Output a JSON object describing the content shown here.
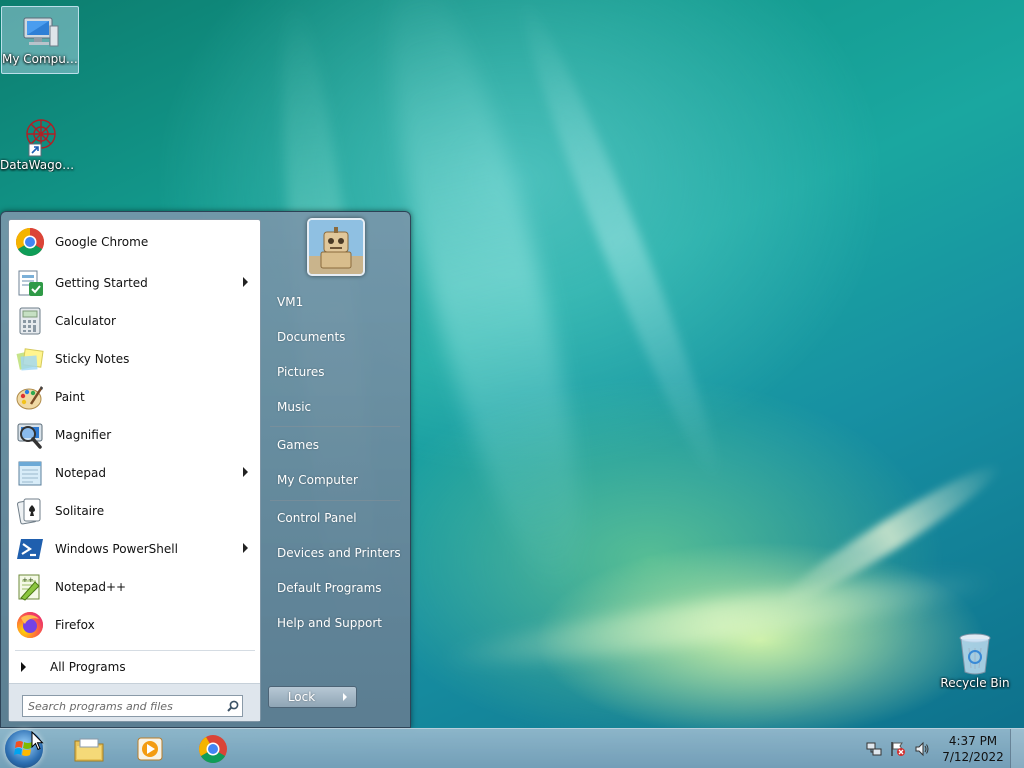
{
  "desktop": {
    "icons": [
      {
        "label": "My Computer",
        "icon": "computer-icon"
      },
      {
        "label": "DataWagon...",
        "icon": "datawagon-icon"
      },
      {
        "label": "Recycle Bin",
        "icon": "recycle-bin-icon"
      }
    ]
  },
  "start_menu": {
    "programs": [
      {
        "label": "Google Chrome",
        "icon": "chrome-icon",
        "submenu": false
      },
      {
        "label": "Getting Started",
        "icon": "getting-started-icon",
        "submenu": true
      },
      {
        "label": "Calculator",
        "icon": "calculator-icon",
        "submenu": false
      },
      {
        "label": "Sticky Notes",
        "icon": "sticky-notes-icon",
        "submenu": false
      },
      {
        "label": "Paint",
        "icon": "paint-icon",
        "submenu": false
      },
      {
        "label": "Magnifier",
        "icon": "magnifier-icon",
        "submenu": false
      },
      {
        "label": "Notepad",
        "icon": "notepad-icon",
        "submenu": true
      },
      {
        "label": "Solitaire",
        "icon": "solitaire-icon",
        "submenu": false
      },
      {
        "label": "Windows PowerShell",
        "icon": "powershell-icon",
        "submenu": true
      },
      {
        "label": "Notepad++",
        "icon": "notepadpp-icon",
        "submenu": false
      },
      {
        "label": "Firefox",
        "icon": "firefox-icon",
        "submenu": false
      }
    ],
    "all_programs_label": "All Programs",
    "search_placeholder": "Search programs and files",
    "right_links": [
      {
        "label": "VM1"
      },
      {
        "label": "Documents"
      },
      {
        "label": "Pictures"
      },
      {
        "label": "Music"
      },
      {
        "label": "Games"
      },
      {
        "label": "My Computer"
      },
      {
        "label": "Control Panel"
      },
      {
        "label": "Devices and Printers"
      },
      {
        "label": "Default Programs"
      },
      {
        "label": "Help and Support"
      }
    ],
    "lock_label": "Lock"
  },
  "taskbar": {
    "apps": [
      "file-explorer-icon",
      "media-player-icon",
      "chrome-icon"
    ],
    "tray_icons": [
      "network-icon",
      "action-center-flag-icon",
      "volume-icon"
    ],
    "time": "4:37 PM",
    "date": "7/12/2022"
  },
  "colors": {
    "menu_frame": "#5f7d91",
    "desktop_base": "#139a8e",
    "taskbar": "#96b9cd"
  }
}
